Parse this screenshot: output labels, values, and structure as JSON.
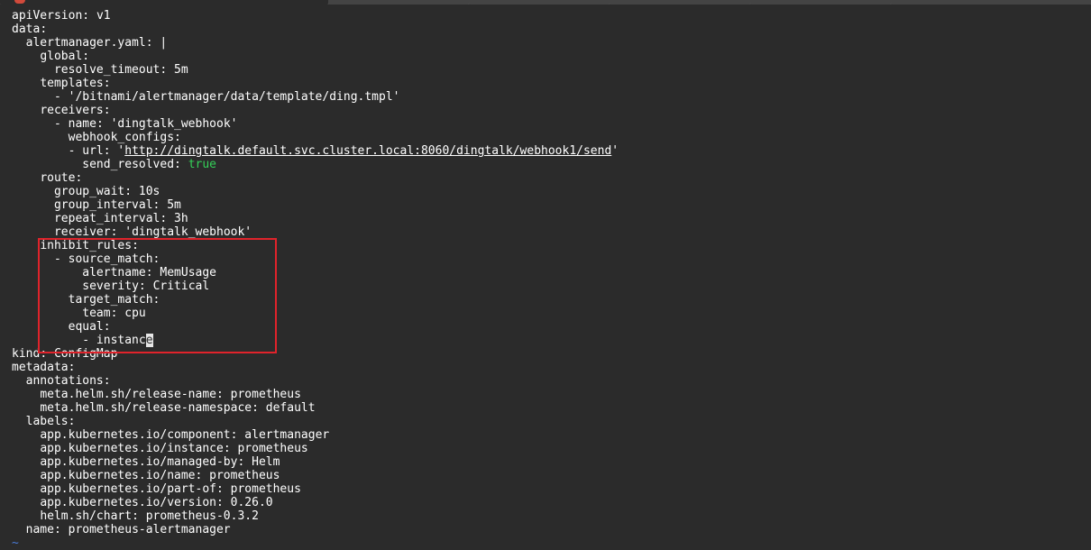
{
  "colors": {
    "background": "#2b2b2b",
    "text": "#ffffff",
    "boolean_value": "#34d058",
    "tilde": "#4a7ad6",
    "highlight_box": "#e0232b",
    "cursor": "#e6e6e6"
  },
  "editor": {
    "lines": [
      {
        "indent": "",
        "key": "apiVersion",
        "sep": ": ",
        "value": "v1"
      },
      {
        "indent": "",
        "key": "data",
        "sep": ":",
        "value": ""
      },
      {
        "indent": "  ",
        "key": "alertmanager.yaml",
        "sep": ": ",
        "value": "|"
      },
      {
        "indent": "    ",
        "key": "global",
        "sep": ":",
        "value": ""
      },
      {
        "indent": "      ",
        "key": "resolve_timeout",
        "sep": ": ",
        "value": "5m"
      },
      {
        "indent": "    ",
        "key": "templates",
        "sep": ":",
        "value": ""
      },
      {
        "indent": "      - ",
        "key": "",
        "sep": "",
        "value": "'/bitnami/alertmanager/data/template/ding.tmpl'"
      },
      {
        "indent": "    ",
        "key": "receivers",
        "sep": ":",
        "value": ""
      },
      {
        "indent": "      - ",
        "key": "name",
        "sep": ": ",
        "value": "'dingtalk_webhook'"
      },
      {
        "indent": "        ",
        "key": "webhook_configs",
        "sep": ":",
        "value": ""
      },
      {
        "indent": "        - ",
        "key": "url",
        "sep": ": ",
        "value_prefix": "'",
        "url": "http://dingtalk.default.svc.cluster.local:8060/dingtalk/webhook1/send",
        "value_suffix": "'",
        "type": "url"
      },
      {
        "indent": "          ",
        "key": "send_resolved",
        "sep": ": ",
        "value": "true",
        "type": "bool"
      },
      {
        "indent": "    ",
        "key": "route",
        "sep": ":",
        "value": ""
      },
      {
        "indent": "      ",
        "key": "group_wait",
        "sep": ": ",
        "value": "10s"
      },
      {
        "indent": "      ",
        "key": "group_interval",
        "sep": ": ",
        "value": "5m"
      },
      {
        "indent": "      ",
        "key": "repeat_interval",
        "sep": ": ",
        "value": "3h"
      },
      {
        "indent": "      ",
        "key": "receiver",
        "sep": ": ",
        "value": "'dingtalk_webhook'"
      },
      {
        "indent": "    ",
        "key": "inhibit_rules",
        "sep": ":",
        "value": ""
      },
      {
        "indent": "      - ",
        "key": "source_match",
        "sep": ":",
        "value": ""
      },
      {
        "indent": "          ",
        "key": "alertname",
        "sep": ": ",
        "value": "MemUsage"
      },
      {
        "indent": "          ",
        "key": "severity",
        "sep": ": ",
        "value": "Critical"
      },
      {
        "indent": "        ",
        "key": "target_match",
        "sep": ":",
        "value": ""
      },
      {
        "indent": "          ",
        "key": "team",
        "sep": ": ",
        "value": "cpu"
      },
      {
        "indent": "        ",
        "key": "equal",
        "sep": ":",
        "value": ""
      },
      {
        "indent": "          - ",
        "key": "",
        "sep": "",
        "value": "instanc",
        "cursor_char": "e",
        "type": "cursor"
      },
      {
        "indent": "",
        "key": "kind",
        "sep": ": ",
        "value": "ConfigMap"
      },
      {
        "indent": "",
        "key": "metadata",
        "sep": ":",
        "value": ""
      },
      {
        "indent": "  ",
        "key": "annotations",
        "sep": ":",
        "value": ""
      },
      {
        "indent": "    ",
        "key": "meta.helm.sh/release-name",
        "sep": ": ",
        "value": "prometheus"
      },
      {
        "indent": "    ",
        "key": "meta.helm.sh/release-namespace",
        "sep": ": ",
        "value": "default"
      },
      {
        "indent": "  ",
        "key": "labels",
        "sep": ":",
        "value": ""
      },
      {
        "indent": "    ",
        "key": "app.kubernetes.io/component",
        "sep": ": ",
        "value": "alertmanager"
      },
      {
        "indent": "    ",
        "key": "app.kubernetes.io/instance",
        "sep": ": ",
        "value": "prometheus"
      },
      {
        "indent": "    ",
        "key": "app.kubernetes.io/managed-by",
        "sep": ": ",
        "value": "Helm"
      },
      {
        "indent": "    ",
        "key": "app.kubernetes.io/name",
        "sep": ": ",
        "value": "prometheus"
      },
      {
        "indent": "    ",
        "key": "app.kubernetes.io/part-of",
        "sep": ": ",
        "value": "prometheus"
      },
      {
        "indent": "    ",
        "key": "app.kubernetes.io/version",
        "sep": ": ",
        "value": "0.26.0"
      },
      {
        "indent": "    ",
        "key": "helm.sh/chart",
        "sep": ": ",
        "value": "prometheus-0.3.2"
      },
      {
        "indent": "  ",
        "key": "name",
        "sep": ": ",
        "value": "prometheus-alertmanager"
      },
      {
        "indent": "",
        "key": "",
        "sep": "",
        "value": "~",
        "type": "tilde"
      }
    ]
  }
}
